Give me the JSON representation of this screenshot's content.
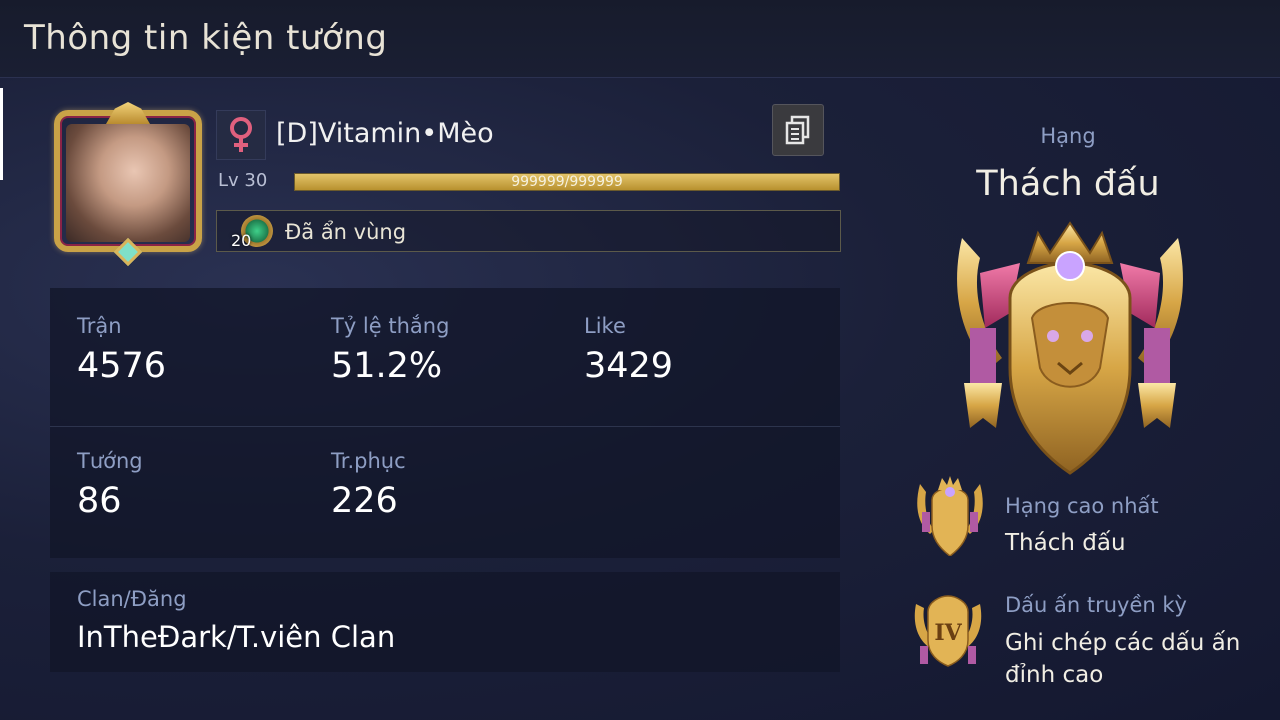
{
  "header": {
    "title": "Thông tin kiện tướng"
  },
  "profile": {
    "name": "[D]Vitamin•Mèo",
    "gender_icon": "female-icon",
    "level_label": "Lv 30",
    "xp_text": "999999/999999",
    "xp_fraction": 1.0,
    "region_badge_number": "20",
    "region_status": "Đã ẩn vùng"
  },
  "stats": {
    "matches_label": "Trận",
    "matches_value": "4576",
    "winrate_label": "Tỷ lệ thắng",
    "winrate_value": "51.2%",
    "like_label": "Like",
    "like_value": "3429",
    "heroes_label": "Tướng",
    "heroes_value": "86",
    "skins_label": "Tr.phục",
    "skins_value": "226"
  },
  "clan": {
    "label": "Clan/Đăng",
    "value": "InTheĐark/T.viên Clan"
  },
  "rank": {
    "label": "Hạng",
    "name": "Thách đấu",
    "highest_label": "Hạng cao nhất",
    "highest_value": "Thách đấu",
    "legend_label": "Dấu ấn truyền kỳ",
    "legend_value_line1": "Ghi chép các dấu ấn",
    "legend_value_line2": "đỉnh cao",
    "legend_badge_text": "IV"
  },
  "colors": {
    "gold": "#c9a247",
    "label_blue": "#8e9ec4",
    "panel": "#121628",
    "gender_pink": "#e0607e"
  }
}
